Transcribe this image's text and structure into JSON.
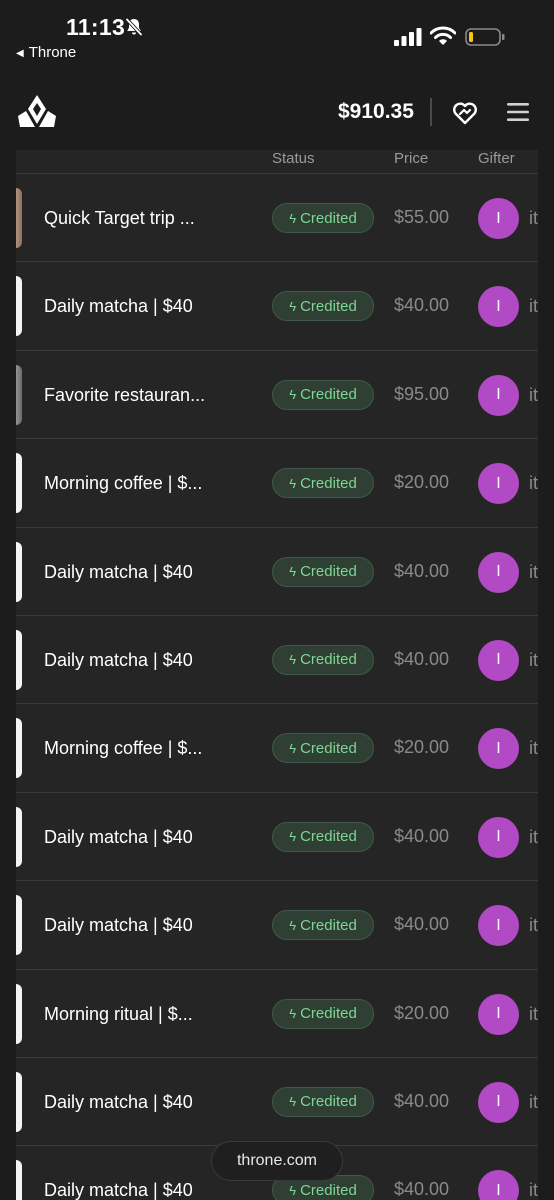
{
  "status_bar": {
    "time": "11:13",
    "back_label": "Throne",
    "icons": [
      "bell-slash-icon",
      "signal-icon",
      "wifi-icon",
      "battery-low-icon"
    ]
  },
  "header": {
    "balance": "$910.35",
    "icons": [
      "throne-logo",
      "gift-heart-icon",
      "hamburger-menu-icon"
    ]
  },
  "table": {
    "columns": {
      "status": "Status",
      "price": "Price",
      "gifter": "Gifter"
    },
    "rows": [
      {
        "name": "Quick Target trip ...",
        "status": "Credited",
        "price": "$55.00",
        "avatar": "I",
        "gifter": "it"
      },
      {
        "name": "Daily matcha | $40",
        "status": "Credited",
        "price": "$40.00",
        "avatar": "I",
        "gifter": "it"
      },
      {
        "name": "Favorite restauran...",
        "status": "Credited",
        "price": "$95.00",
        "avatar": "I",
        "gifter": "it"
      },
      {
        "name": "Morning coffee | $...",
        "status": "Credited",
        "price": "$20.00",
        "avatar": "I",
        "gifter": "it"
      },
      {
        "name": "Daily matcha | $40",
        "status": "Credited",
        "price": "$40.00",
        "avatar": "I",
        "gifter": "it"
      },
      {
        "name": "Daily matcha | $40",
        "status": "Credited",
        "price": "$40.00",
        "avatar": "I",
        "gifter": "it"
      },
      {
        "name": "Morning coffee | $...",
        "status": "Credited",
        "price": "$20.00",
        "avatar": "I",
        "gifter": "it"
      },
      {
        "name": "Daily matcha | $40",
        "status": "Credited",
        "price": "$40.00",
        "avatar": "I",
        "gifter": "it"
      },
      {
        "name": "Daily matcha | $40",
        "status": "Credited",
        "price": "$40.00",
        "avatar": "I",
        "gifter": "it"
      },
      {
        "name": "Morning ritual | $...",
        "status": "Credited",
        "price": "$20.00",
        "avatar": "I",
        "gifter": "it"
      },
      {
        "name": "Daily matcha | $40",
        "status": "Credited",
        "price": "$40.00",
        "avatar": "I",
        "gifter": "it"
      },
      {
        "name": "Daily matcha | $40",
        "status": "Credited",
        "price": "$40.00",
        "avatar": "I",
        "gifter": "it"
      }
    ]
  },
  "footer": {
    "domain": "throne.com"
  },
  "colors": {
    "credited_text": "#7fd694",
    "credited_bg": "#2f3f33",
    "avatar": "#b14ac4",
    "background": "#1c1c1c"
  }
}
